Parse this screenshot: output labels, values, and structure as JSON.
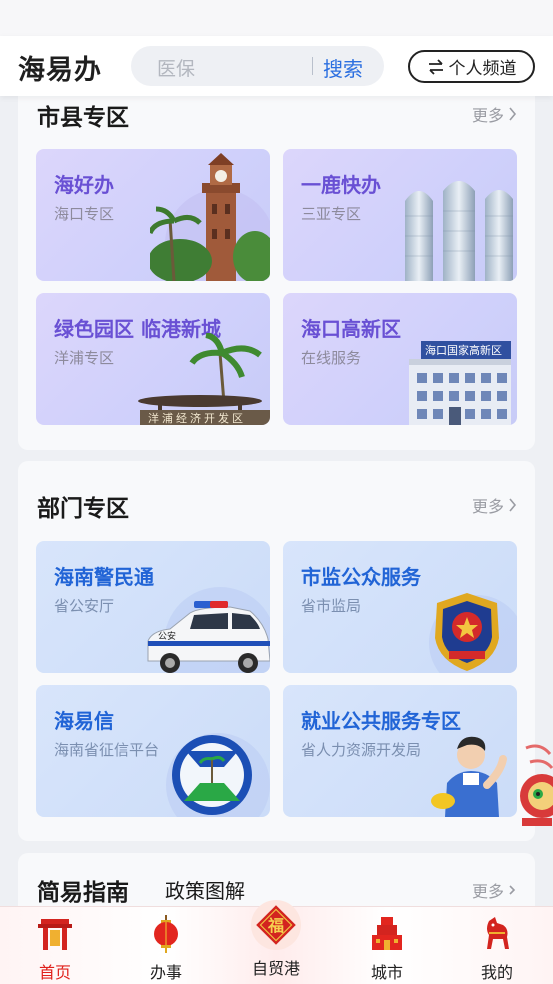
{
  "header": {
    "app_name": "海易办",
    "search_placeholder": "医保",
    "search_button": "搜索",
    "channel_button": "个人频道"
  },
  "city_section": {
    "title": "市县专区",
    "more": "更多",
    "cards": [
      {
        "title": "海好办",
        "subtitle": "海口专区"
      },
      {
        "title": "一鹿快办",
        "subtitle": "三亚专区"
      },
      {
        "title": "绿色园区 临港新城",
        "subtitle": "洋浦专区",
        "sign_text": "洋浦经济开发区"
      },
      {
        "title": "海口高新区",
        "subtitle": "在线服务",
        "sign_text": "海口国家高新区"
      }
    ]
  },
  "dept_section": {
    "title": "部门专区",
    "more": "更多",
    "cards": [
      {
        "title": "海南警民通",
        "subtitle": "省公安厅",
        "car_text": "公安"
      },
      {
        "title": "市监公众服务",
        "subtitle": "省市监局"
      },
      {
        "title": "海易信",
        "subtitle": "海南省征信平台"
      },
      {
        "title": "就业公共服务专区",
        "subtitle": "省人力资源开发局"
      }
    ]
  },
  "guide_section": {
    "title": "简易指南",
    "tab2": "政策图解",
    "more": "更多"
  },
  "bottom_nav": [
    {
      "label": "首页",
      "icon": "gate-icon"
    },
    {
      "label": "办事",
      "icon": "lantern-icon"
    },
    {
      "label": "自贸港",
      "icon": "fu-icon",
      "badge": "福"
    },
    {
      "label": "城市",
      "icon": "building-icon"
    },
    {
      "label": "我的",
      "icon": "horse-icon"
    }
  ],
  "colors": {
    "accent_blue": "#2c6fe0",
    "purple_title": "#6950d4",
    "active_red": "#e0201b"
  }
}
